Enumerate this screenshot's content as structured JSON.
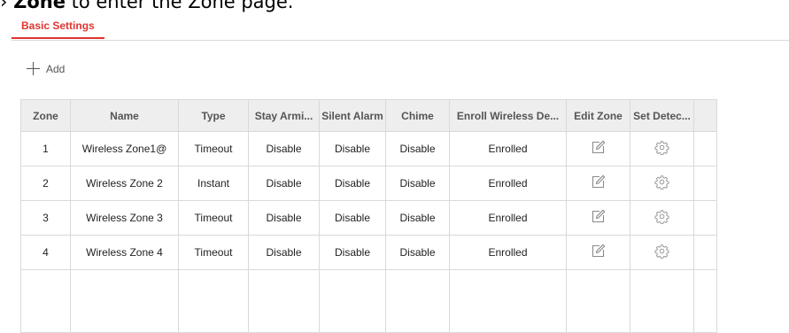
{
  "doc_fragment": {
    "arrow": "›",
    "bold": "Zone",
    "rest": " to enter the Zone page."
  },
  "tabs": [
    {
      "label": "Basic Settings",
      "active": true
    }
  ],
  "toolbar": {
    "add_label": "Add"
  },
  "table": {
    "columns": [
      "Zone",
      "Name",
      "Type",
      "Stay Armi...",
      "Silent Alarm",
      "Chime",
      "Enroll Wireless De...",
      "Edit Zone",
      "Set Detec..."
    ],
    "rows": [
      {
        "zone": "1",
        "name": "Wireless Zone1@",
        "type": "Timeout",
        "stay_arm": "Disable",
        "silent_alarm": "Disable",
        "chime": "Disable",
        "enroll": "Enrolled",
        "edit_icon": "edit-icon",
        "set_icon": "gear-icon"
      },
      {
        "zone": "2",
        "name": "Wireless Zone 2",
        "type": "Instant",
        "stay_arm": "Disable",
        "silent_alarm": "Disable",
        "chime": "Disable",
        "enroll": "Enrolled",
        "edit_icon": "edit-icon",
        "set_icon": "gear-icon"
      },
      {
        "zone": "3",
        "name": "Wireless Zone 3",
        "type": "Timeout",
        "stay_arm": "Disable",
        "silent_alarm": "Disable",
        "chime": "Disable",
        "enroll": "Enrolled",
        "edit_icon": "edit-icon",
        "set_icon": "gear-icon"
      },
      {
        "zone": "4",
        "name": "Wireless Zone 4",
        "type": "Timeout",
        "stay_arm": "Disable",
        "silent_alarm": "Disable",
        "chime": "Disable",
        "enroll": "Enrolled",
        "edit_icon": "edit-icon",
        "set_icon": "gear-icon"
      }
    ]
  },
  "colors": {
    "accent": "#e0342f",
    "header_bg": "#eeeeee",
    "border": "#d9d9d9",
    "icon": "#8a8a8a"
  }
}
